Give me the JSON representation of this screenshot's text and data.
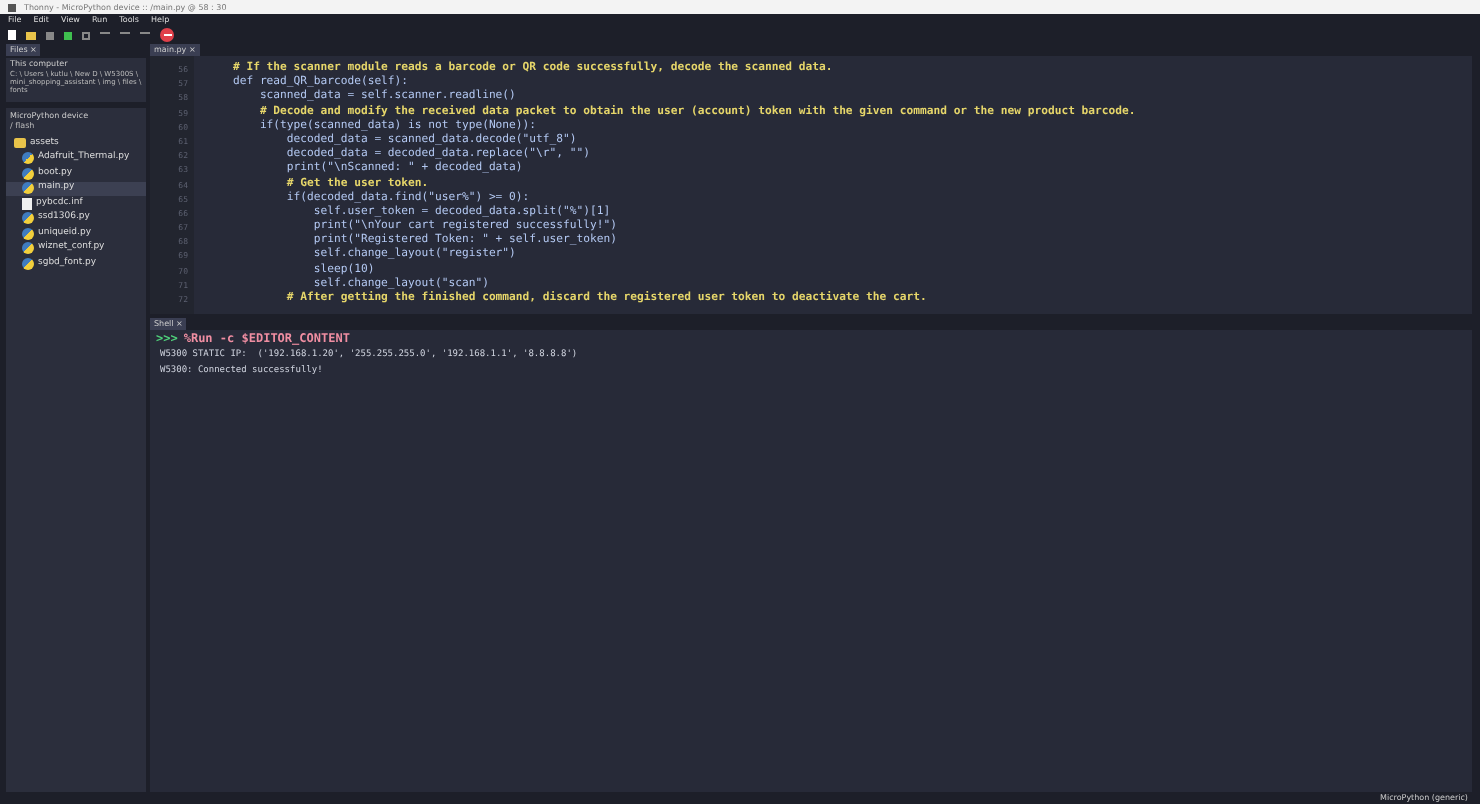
{
  "window": {
    "title": "Thonny - MicroPython device :: /main.py @ 58 : 30"
  },
  "menu": [
    "File",
    "Edit",
    "View",
    "Run",
    "Tools",
    "Help"
  ],
  "files_panel": {
    "tab": "Files ×",
    "this_computer": {
      "title": "This computer",
      "path": "C: \\ Users \\ kutlu \\ New D \\ W5300S \\ mini_shopping_assistant \\ img \\ files \\ fonts"
    },
    "device": {
      "title": "MicroPython device",
      "path": "/ flash"
    },
    "items": [
      {
        "name": "assets",
        "kind": "folder",
        "selected": false
      },
      {
        "name": "Adafruit_Thermal.py",
        "kind": "python",
        "selected": false
      },
      {
        "name": "boot.py",
        "kind": "python",
        "selected": false
      },
      {
        "name": "main.py",
        "kind": "python",
        "selected": true
      },
      {
        "name": "pybcdc.inf",
        "kind": "file",
        "selected": false
      },
      {
        "name": "ssd1306.py",
        "kind": "python",
        "selected": false
      },
      {
        "name": "uniqueid.py",
        "kind": "python",
        "selected": false
      },
      {
        "name": "wiznet_conf.py",
        "kind": "python",
        "selected": false
      },
      {
        "name": "sgbd_font.py",
        "kind": "python",
        "selected": false
      }
    ]
  },
  "editor": {
    "tab": "main.py ×",
    "lines": [
      {
        "num": "56",
        "kind": "comment",
        "text": "    # If the scanner module reads a barcode or QR code successfully, decode the scanned data."
      },
      {
        "num": "57",
        "kind": "code",
        "text": "    def read_QR_barcode(self):"
      },
      {
        "num": "58",
        "kind": "code",
        "text": "        scanned_data = self.scanner.readline()"
      },
      {
        "num": "59",
        "kind": "comment",
        "text": "        # Decode and modify the received data packet to obtain the user (account) token with the given command or the new product barcode."
      },
      {
        "num": "60",
        "kind": "code",
        "text": "        if(type(scanned_data) is not type(None)):"
      },
      {
        "num": "61",
        "kind": "code",
        "text": "            decoded_data = scanned_data.decode(\"utf_8\")"
      },
      {
        "num": "62",
        "kind": "code",
        "text": "            decoded_data = decoded_data.replace(\"\\r\", \"\")"
      },
      {
        "num": "63",
        "kind": "code",
        "text": "            print(\"\\nScanned: \" + decoded_data)"
      },
      {
        "num": "64",
        "kind": "comment",
        "text": "            # Get the user token."
      },
      {
        "num": "65",
        "kind": "code",
        "text": "            if(decoded_data.find(\"user%\") >= 0):"
      },
      {
        "num": "66",
        "kind": "code",
        "text": "                self.user_token = decoded_data.split(\"%\")[1]"
      },
      {
        "num": "67",
        "kind": "code",
        "text": "                print(\"\\nYour cart registered successfully!\")"
      },
      {
        "num": "68",
        "kind": "code",
        "text": "                print(\"Registered Token: \" + self.user_token)"
      },
      {
        "num": "69",
        "kind": "code",
        "text": "                self.change_layout(\"register\")"
      },
      {
        "num": "70",
        "kind": "code",
        "text": "                sleep(10)"
      },
      {
        "num": "71",
        "kind": "code",
        "text": "                self.change_layout(\"scan\")"
      },
      {
        "num": "72",
        "kind": "comment",
        "text": "            # After getting the finished command, discard the registered user token to deactivate the cart."
      }
    ]
  },
  "shell": {
    "tab": "Shell ×",
    "prompt": ">>>",
    "command": "%Run -c $EDITOR_CONTENT",
    "output": [
      "W5300 STATIC IP:  ('192.168.1.20', '255.255.255.0', '192.168.1.1', '8.8.8.8')",
      "W5300: Connected successfully!"
    ]
  },
  "status_bar": "MicroPython (generic)"
}
